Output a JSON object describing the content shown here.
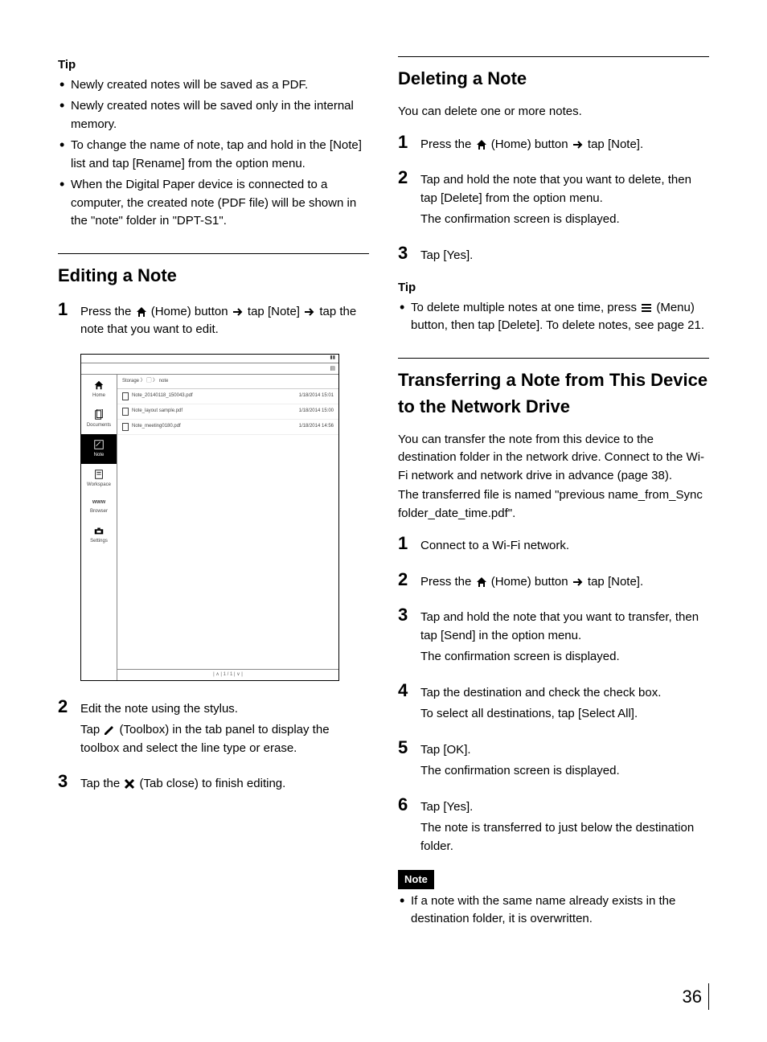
{
  "left": {
    "tip_label": "Tip",
    "tips": [
      "Newly created notes will be saved as a PDF.",
      "Newly created notes will be saved only in the internal memory.",
      "To change the name of note, tap and hold in the [Note] list and tap [Rename] from the option menu.",
      "When the Digital Paper device is connected to a computer, the created note (PDF file) will be shown in the \"note\" folder in \"DPT-S1\"."
    ],
    "editing": {
      "heading": "Editing a Note",
      "step1_a": "Press the ",
      "step1_b": " (Home) button ",
      "step1_c": " tap [Note] ",
      "step1_d": " tap the note that you want to edit.",
      "step2_a": "Edit the note using the stylus.",
      "step2_b": "Tap ",
      "step2_c": " (Toolbox) in the tab panel to display the toolbox and select the line type or erase.",
      "step3_a": "Tap the ",
      "step3_b": " (Tab close) to finish editing."
    },
    "screenshot": {
      "breadcrumb": "Storage  〉 ▢  〉 note",
      "sidebar": [
        "Home",
        "Documents",
        "Note",
        "Workspace",
        "Browser",
        "Settings"
      ],
      "rows": [
        {
          "name": "Note_20140118_150043.pdf",
          "date": "1/18/2014 15:01"
        },
        {
          "name": "Note_layout sample.pdf",
          "date": "1/18/2014 15:00"
        },
        {
          "name": "Note_meeting0180.pdf",
          "date": "1/18/2014 14:56"
        }
      ],
      "pager": "|  ∧  |    1 / 1    |  ∨  |"
    }
  },
  "right": {
    "deleting": {
      "heading": "Deleting a Note",
      "intro": "You can delete one or more notes.",
      "step1_a": "Press the ",
      "step1_b": " (Home) button ",
      "step1_c": " tap [Note].",
      "step2_a": "Tap and hold the note that you want to delete, then tap [Delete] from the option menu.",
      "step2_b": "The confirmation screen is displayed.",
      "step3": "Tap [Yes].",
      "tip_label": "Tip",
      "tip_a": "To delete multiple notes at one time, press ",
      "tip_b": " (Menu) button, then tap [Delete]. To delete notes, see page 21."
    },
    "transferring": {
      "heading": "Transferring a Note from This Device to the Network Drive",
      "intro1": "You can transfer the note from this device to the destination folder in the network drive. Connect to the Wi-Fi network and network drive in advance (page 38).",
      "intro2": "The transferred file is named \"previous name_from_Sync folder_date_time.pdf\".",
      "step1": "Connect to a Wi-Fi network.",
      "step2_a": "Press the ",
      "step2_b": " (Home) button ",
      "step2_c": " tap [Note].",
      "step3_a": "Tap and hold the note that you want to transfer, then tap [Send] in the option menu.",
      "step3_b": "The confirmation screen is displayed.",
      "step4_a": "Tap the destination and check the check box.",
      "step4_b": "To select all destinations, tap [Select All].",
      "step5_a": "Tap [OK].",
      "step5_b": "The confirmation screen is displayed.",
      "step6_a": "Tap [Yes].",
      "step6_b": "The note is transferred to just below the destination folder.",
      "note_label": "Note",
      "note_text": "If a note with the same name already exists in the destination folder, it is overwritten."
    }
  },
  "page_number": "36"
}
